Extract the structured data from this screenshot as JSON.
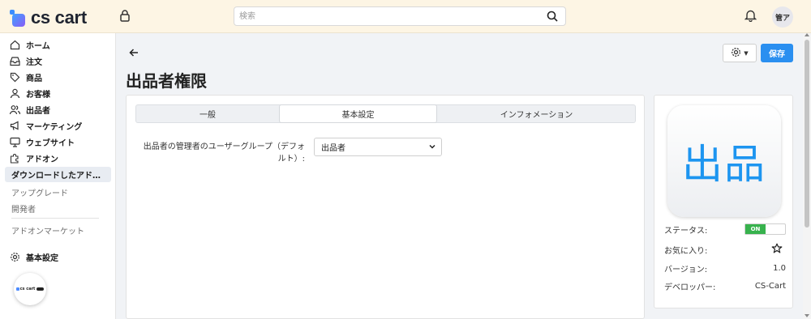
{
  "app": {
    "name": "cs cart"
  },
  "header": {
    "search_placeholder": "検索",
    "user_initials": "管ア"
  },
  "sidebar": {
    "items": [
      {
        "label": "ホーム",
        "icon": "home-icon"
      },
      {
        "label": "注文",
        "icon": "inbox-icon"
      },
      {
        "label": "商品",
        "icon": "tag-icon"
      },
      {
        "label": "お客様",
        "icon": "user-icon"
      },
      {
        "label": "出品者",
        "icon": "users-icon"
      },
      {
        "label": "マーケティング",
        "icon": "megaphone-icon"
      },
      {
        "label": "ウェブサイト",
        "icon": "monitor-icon"
      },
      {
        "label": "アドオン",
        "icon": "puzzle-icon"
      }
    ],
    "active_item": "ダウンロードしたアド…",
    "sub_items": [
      "アップグレード",
      "開発者"
    ],
    "marketplace": "アドオンマーケット",
    "settings": {
      "label": "基本設定",
      "icon": "gear-icon"
    },
    "badge_text": "cs cart"
  },
  "page": {
    "title": "出品者権限",
    "save_label": "保存"
  },
  "tabs": [
    {
      "label": "一般",
      "active": false
    },
    {
      "label": "基本設定",
      "active": true
    },
    {
      "label": "インフォメーション",
      "active": false
    }
  ],
  "form": {
    "field_label": "出品者の管理者のユーザーグループ（デフォルト）:",
    "selected_value": "出品者"
  },
  "addon_info": {
    "logo_text": "出品",
    "status_label": "ステータス:",
    "status_value": "ON",
    "favorite_label": "お気に入り:",
    "version_label": "バージョン:",
    "version_value": "1.0",
    "developer_label": "デベロッパー:",
    "developer_value": "CS-Cart"
  },
  "colors": {
    "accent": "#2a8ff0",
    "status_on": "#37b24d",
    "header_bg": "#fdf5e4",
    "logo_text": "#1d95f0"
  }
}
